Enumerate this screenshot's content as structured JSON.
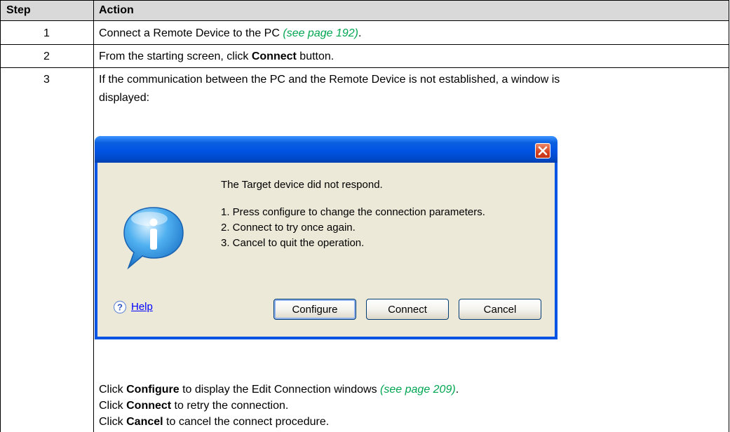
{
  "table": {
    "headers": {
      "step": "Step",
      "action": "Action"
    },
    "rows": [
      {
        "step": "1",
        "text": "Connect a Remote Device to the PC ",
        "link": "(see page 192)",
        "suffix": "."
      },
      {
        "step": "2",
        "text_pre": "From the starting screen, click ",
        "bold": "Connect",
        "text_post": " button."
      },
      {
        "step": "3",
        "line1": "If the communication between the PC and the Remote Device is not established, a window is",
        "line2": "displayed:",
        "notes": [
          {
            "pre": "Click ",
            "bold": "Configure",
            "mid": " to display the Edit Connection windows ",
            "link": "(see page 209)",
            "post": "."
          },
          {
            "pre": "Click ",
            "bold": "Connect",
            "mid": " to retry the connection.",
            "link": "",
            "post": ""
          },
          {
            "pre": "Click ",
            "bold": "Cancel",
            "mid": " to cancel the connect procedure.",
            "link": "",
            "post": ""
          }
        ]
      }
    ]
  },
  "dialog": {
    "icon": "info-icon",
    "close_icon": "close-icon",
    "heading": "The Target device did not respond.",
    "lines": [
      "1. Press configure to change the connection parameters.",
      "2. Connect to try once again.",
      "3. Cancel to quit the operation."
    ],
    "help_label": "Help",
    "buttons": {
      "configure": "Configure",
      "connect": "Connect",
      "cancel": "Cancel"
    }
  },
  "colors": {
    "link": "#00a651",
    "title_bar": "#0054e3",
    "dialog_bg": "#ece9d8",
    "header_bg": "#d9d9d9"
  }
}
